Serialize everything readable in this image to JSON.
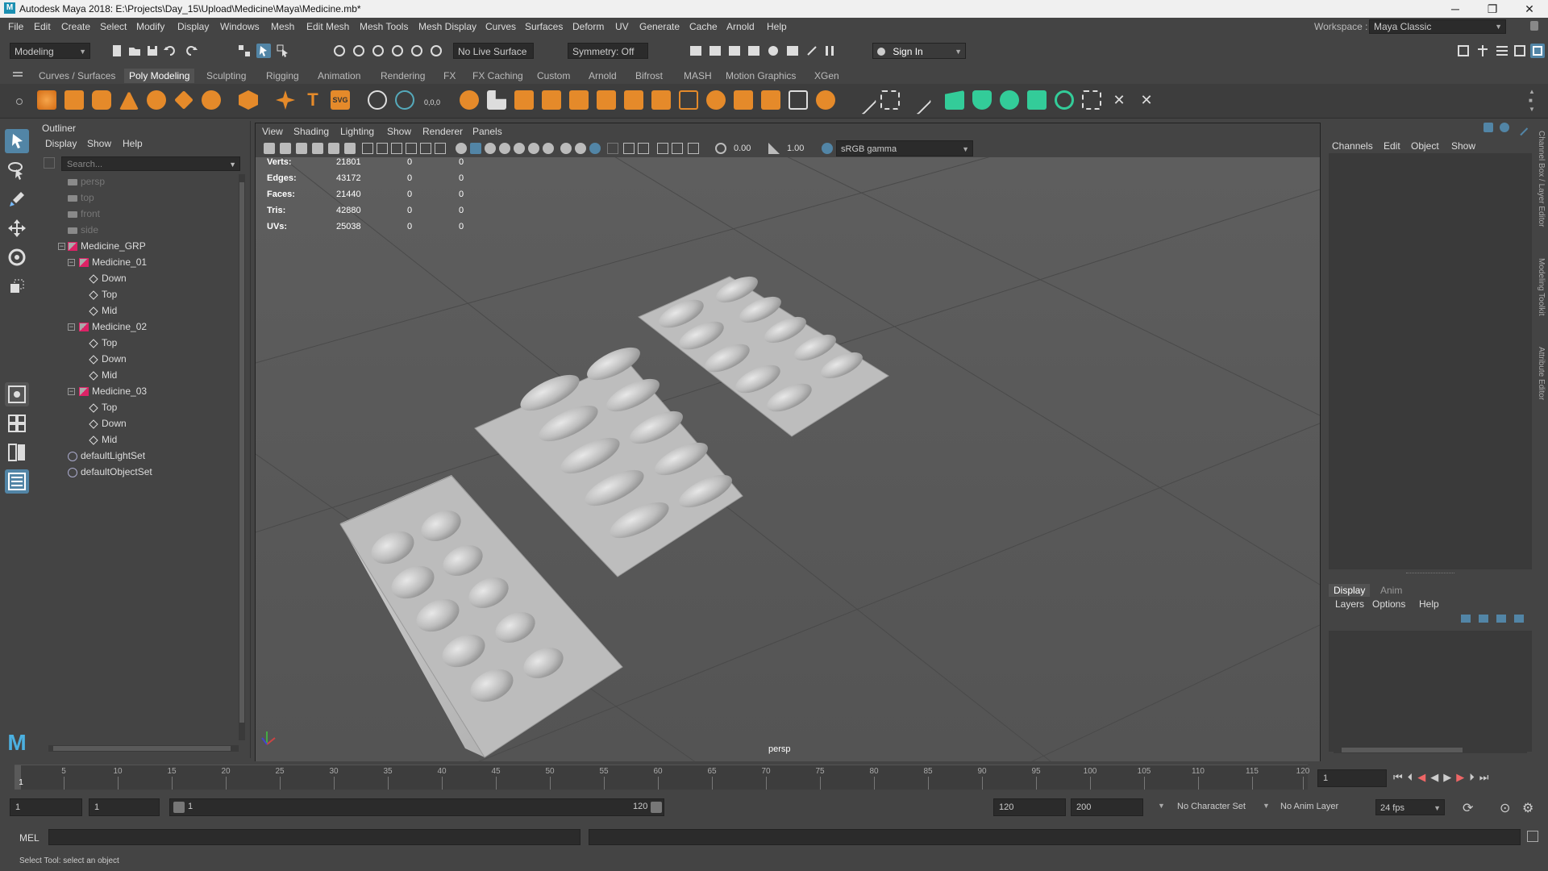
{
  "window": {
    "title": "Autodesk Maya 2018: E:\\Projects\\Day_15\\Upload\\Medicine\\Maya\\Medicine.mb*",
    "min": "─",
    "max": "❐",
    "close": "✕"
  },
  "menubar": [
    "File",
    "Edit",
    "Create",
    "Select",
    "Modify",
    "Display",
    "Windows",
    "Mesh",
    "Edit Mesh",
    "Mesh Tools",
    "Mesh Display",
    "Curves",
    "Surfaces",
    "Deform",
    "UV",
    "Generate",
    "Cache",
    "Arnold",
    "Help"
  ],
  "workspace": {
    "label": "Workspace :",
    "value": "Maya Classic"
  },
  "statusline": {
    "mode": "Modeling",
    "live_surface": "No Live Surface",
    "symmetry": "Symmetry: Off",
    "sign_in": "Sign In"
  },
  "shelf_tabs": [
    "Curves / Surfaces",
    "Poly Modeling",
    "Sculpting",
    "Rigging",
    "Animation",
    "Rendering",
    "FX",
    "FX Caching",
    "Custom",
    "Arnold",
    "Bifrost",
    "MASH",
    "Motion Graphics",
    "XGen"
  ],
  "active_shelf": "Poly Modeling",
  "outliner": {
    "title": "Outliner",
    "menu": [
      "Display",
      "Show",
      "Help"
    ],
    "search_placeholder": "Search...",
    "items": [
      {
        "label": "persp",
        "type": "camera",
        "depth": 1
      },
      {
        "label": "top",
        "type": "camera",
        "depth": 1
      },
      {
        "label": "front",
        "type": "camera",
        "depth": 1
      },
      {
        "label": "side",
        "type": "camera",
        "depth": 1
      },
      {
        "label": "Medicine_GRP",
        "type": "group",
        "depth": 1
      },
      {
        "label": "Medicine_01",
        "type": "group",
        "depth": 2
      },
      {
        "label": "Down",
        "type": "mesh",
        "depth": 3
      },
      {
        "label": "Top",
        "type": "mesh",
        "depth": 3
      },
      {
        "label": "Mid",
        "type": "mesh",
        "depth": 3
      },
      {
        "label": "Medicine_02",
        "type": "group",
        "depth": 2
      },
      {
        "label": "Top",
        "type": "mesh",
        "depth": 3
      },
      {
        "label": "Down",
        "type": "mesh",
        "depth": 3
      },
      {
        "label": "Mid",
        "type": "mesh",
        "depth": 3
      },
      {
        "label": "Medicine_03",
        "type": "group",
        "depth": 2
      },
      {
        "label": "Top",
        "type": "mesh",
        "depth": 3
      },
      {
        "label": "Down",
        "type": "mesh",
        "depth": 3
      },
      {
        "label": "Mid",
        "type": "mesh",
        "depth": 3
      },
      {
        "label": "defaultLightSet",
        "type": "set",
        "depth": 1
      },
      {
        "label": "defaultObjectSet",
        "type": "set",
        "depth": 1
      }
    ]
  },
  "viewport": {
    "menu": [
      "View",
      "Shading",
      "Lighting",
      "Show",
      "Renderer",
      "Panels"
    ],
    "exposure": "0.00",
    "gamma": "1.00",
    "color_space": "sRGB gamma",
    "camera_label": "persp",
    "hud": [
      {
        "label": "Verts:",
        "v1": "21801",
        "v2": "0",
        "v3": "0"
      },
      {
        "label": "Edges:",
        "v1": "43172",
        "v2": "0",
        "v3": "0"
      },
      {
        "label": "Faces:",
        "v1": "21440",
        "v2": "0",
        "v3": "0"
      },
      {
        "label": "Tris:",
        "v1": "42880",
        "v2": "0",
        "v3": "0"
      },
      {
        "label": "UVs:",
        "v1": "25038",
        "v2": "0",
        "v3": "0"
      }
    ]
  },
  "channelbox": {
    "menu": [
      "Channels",
      "Edit",
      "Object",
      "Show"
    ],
    "layer_tabs": [
      "Display",
      "Anim"
    ],
    "layer_menu": [
      "Layers",
      "Options",
      "Help"
    ]
  },
  "side_tabs": [
    "Channel Box / Layer Editor",
    "Modeling Toolkit",
    "Attribute Editor"
  ],
  "timeline": {
    "ticks": [
      "1",
      "5",
      "10",
      "15",
      "20",
      "25",
      "30",
      "35",
      "40",
      "45",
      "50",
      "55",
      "60",
      "65",
      "70",
      "75",
      "80",
      "85",
      "90",
      "95",
      "100",
      "105",
      "110",
      "115",
      "120"
    ],
    "current_frame": "1"
  },
  "range": {
    "start": "1",
    "playback_start": "1",
    "slider_start": "1",
    "slider_end": "120",
    "playback_end": "120",
    "end": "200",
    "character_set": "No Character Set",
    "anim_layer": "No Anim Layer",
    "fps": "24 fps"
  },
  "cmdline": {
    "label": "MEL"
  },
  "helpline": {
    "text": "Select Tool: select an object"
  },
  "colors": {
    "accent": "#5285a6",
    "bg": "#444444",
    "viewport": "#595959"
  }
}
